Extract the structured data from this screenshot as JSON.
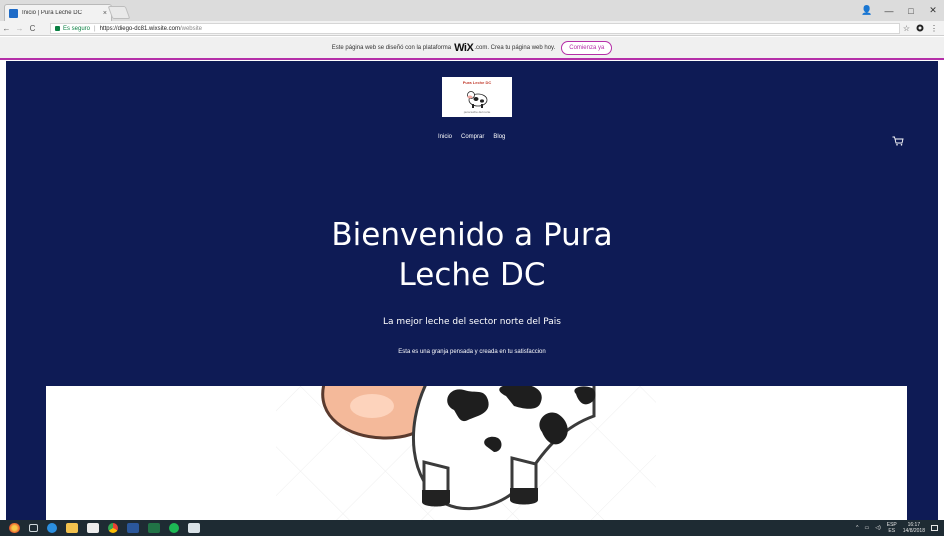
{
  "browser": {
    "tab_title": "Inicio | Pura Leche DC",
    "tab_close": "×",
    "window_controls": {
      "profile": "👤",
      "minimize": "—",
      "maximize": "□",
      "close": "✕"
    },
    "nav": {
      "back": "←",
      "forward": "→",
      "reload": "C"
    },
    "secure_label": "Es seguro",
    "url_separator": "|",
    "url_main": "https://diego-dc81.wixsite.com",
    "url_path": "/website",
    "bookmark_icon": "☆"
  },
  "wix_banner": {
    "text_before": "Este página web se diseñó con la plataforma",
    "logo": "WiX",
    "text_after": ".com. Crea tu página web hoy.",
    "cta": "Comienza ya"
  },
  "site": {
    "logo": {
      "title": "Pura Leche DC",
      "subtitle": "pura leche del norte"
    },
    "nav": [
      "Inicio",
      "Comprar",
      "Blog"
    ],
    "hero": {
      "title_line1": "Bienvenido a Pura",
      "title_line2": "Leche DC",
      "subtitle": "La mejor leche del sector norte del Pais",
      "description": "Esta es una granja pensada y creada en tu satisfaccion"
    }
  },
  "taskbar": {
    "tray": {
      "lang_top": "ESP",
      "lang_bottom": "ES",
      "time": "16:17",
      "date": "14/8/2018"
    }
  },
  "colors": {
    "site_background": "#0e1b55",
    "wix_accent": "#b52fa8",
    "taskbar": "#1e2b33"
  }
}
